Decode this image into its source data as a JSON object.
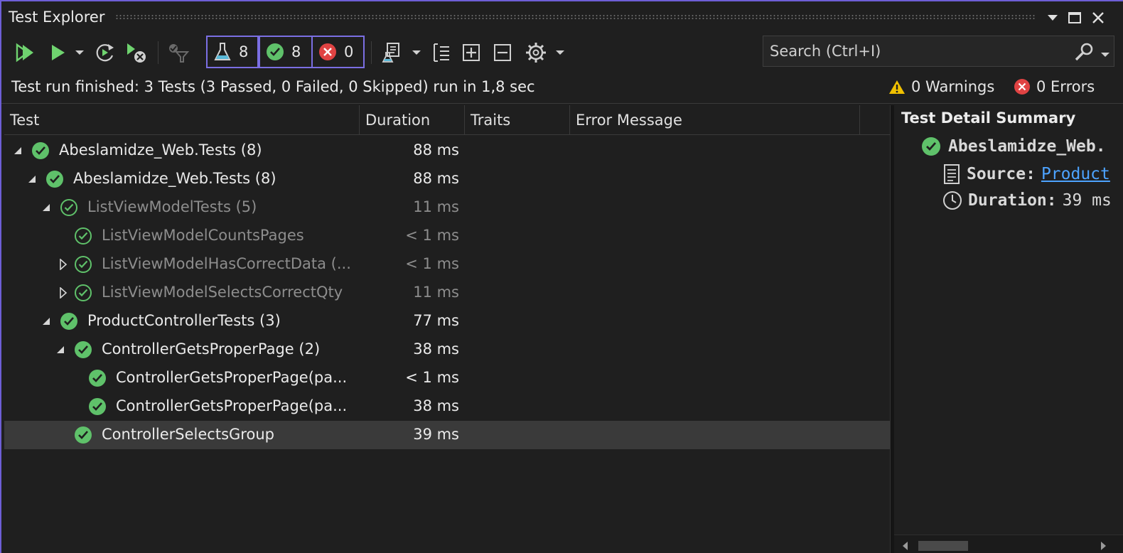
{
  "window": {
    "title": "Test Explorer"
  },
  "toolbar": {
    "counts": {
      "total": "8",
      "passed": "8",
      "failed": "0"
    },
    "search_placeholder": "Search (Ctrl+I)"
  },
  "status": {
    "message": "Test run finished: 3 Tests (3 Passed, 0 Failed, 0 Skipped) run in 1,8 sec",
    "warnings": "0 Warnings",
    "errors": "0 Errors"
  },
  "grid": {
    "columns": [
      "Test",
      "Duration",
      "Traits",
      "Error Message"
    ],
    "rows": [
      {
        "label": "Abeslamidze_Web.Tests",
        "count": "(8)",
        "duration": "88 ms"
      },
      {
        "label": "Abeslamidze_Web.Tests",
        "count": "(8)",
        "duration": "88 ms"
      },
      {
        "label": "ListViewModelTests",
        "count": "(5)",
        "duration": "11 ms"
      },
      {
        "label": "ListViewModelCountsPages",
        "count": "",
        "duration": "< 1 ms"
      },
      {
        "label": "ListViewModelHasCorrectData",
        "count": "(...",
        "duration": "< 1 ms"
      },
      {
        "label": "ListViewModelSelectsCorrectQty",
        "count": "",
        "duration": "11 ms"
      },
      {
        "label": "ProductControllerTests",
        "count": "(3)",
        "duration": "77 ms"
      },
      {
        "label": "ControllerGetsProperPage",
        "count": "(2)",
        "duration": "38 ms"
      },
      {
        "label": "ControllerGetsProperPage(pa...",
        "count": "",
        "duration": "< 1 ms"
      },
      {
        "label": "ControllerGetsProperPage(pa...",
        "count": "",
        "duration": "38 ms"
      },
      {
        "label": "ControllerSelectsGroup",
        "count": "",
        "duration": "39 ms"
      }
    ]
  },
  "detail": {
    "title": "Test Detail Summary",
    "test_name": "Abeslamidze_Web.",
    "source_label": "Source:",
    "source_link": "Product",
    "duration_label": "Duration:",
    "duration_value": "39 ms"
  },
  "colors": {
    "accent": "#6e5fd6",
    "pass": "#5fc16a",
    "fail": "#e04343",
    "warn": "#f0c000",
    "link": "#4da3ff"
  }
}
